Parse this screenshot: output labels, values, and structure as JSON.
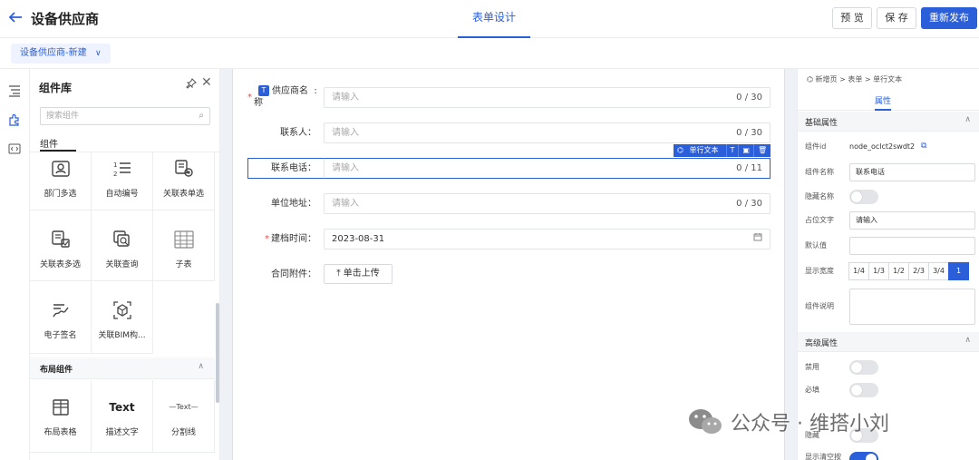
{
  "header": {
    "back_icon": "arrow-left-icon",
    "title": "设备供应商",
    "center_tab": "表单设计",
    "preview_label": "预 览",
    "save_label": "保 存",
    "publish_label": "重新发布"
  },
  "subbar": {
    "form_name": "设备供应商-新建"
  },
  "rail": {
    "icons": [
      "outline-icon",
      "puzzle-icon",
      "code-icon"
    ]
  },
  "library": {
    "title": "组件库",
    "search_placeholder": "搜索组件",
    "tab": "组件",
    "items": [
      {
        "label": "部门多选",
        "icon": "department-icon"
      },
      {
        "label": "自动编号",
        "icon": "numbered-list-icon"
      },
      {
        "label": "关联表单选",
        "icon": "relation-single-icon"
      },
      {
        "label": "关联表多选",
        "icon": "relation-multi-icon"
      },
      {
        "label": "关联查询",
        "icon": "relation-query-icon"
      },
      {
        "label": "子表",
        "icon": "table-icon"
      },
      {
        "label": "电子签名",
        "icon": "signature-icon"
      },
      {
        "label": "关联BIM构...",
        "icon": "cube-icon"
      }
    ],
    "layout_section": "布局组件",
    "layout_items": [
      {
        "label": "布局表格",
        "icon": "grid-icon"
      },
      {
        "label": "描述文字",
        "sample": "Text"
      },
      {
        "label": "分割线",
        "sample": "—Text—"
      }
    ]
  },
  "form": {
    "fields": [
      {
        "label_line1": "供应商名",
        "label_line2": "称",
        "required": true,
        "placeholder": "请输入",
        "counter": "0 / 30",
        "type_badge": "T"
      },
      {
        "label": "联系人：",
        "required": false,
        "placeholder": "请输入",
        "counter": "0 / 30"
      },
      {
        "label": "联系电话：",
        "required": false,
        "placeholder": "请输入",
        "counter": "0 / 11"
      },
      {
        "label": "单位地址：",
        "required": false,
        "placeholder": "请输入",
        "counter": "0 / 30"
      },
      {
        "label": "建档时间：",
        "required": true,
        "value": "2023-08-31",
        "icon": "calendar-icon"
      },
      {
        "label": "合同附件：",
        "required": false,
        "button": "单击上传",
        "icon": "upload-icon"
      }
    ],
    "selected_toolbar": {
      "type_label": "单行文本",
      "text_icon": "T",
      "copy_icon": "copy-icon",
      "delete_icon": "trash-icon"
    }
  },
  "props": {
    "breadcrumb": "新增页 > 表单 > 单行文本",
    "tab": "属性",
    "basic_section": "基础属性",
    "component_id_label": "组件id",
    "component_id_value": "node_oclct2swdt2",
    "component_name_label": "组件名称",
    "component_name_value": "联系电话",
    "hide_name_label": "隐藏名称",
    "placeholder_label": "占位文字",
    "placeholder_value": "请输入",
    "default_label": "默认值",
    "default_value": "",
    "width_label": "显示宽度",
    "width_options": [
      "1/4",
      "1/3",
      "1/2",
      "2/3",
      "3/4",
      "1"
    ],
    "width_selected": "1",
    "desc_label": "组件说明",
    "advanced_section": "高级属性",
    "disabled_label": "禁用",
    "required_label": "必填",
    "hidden_label": "隐藏",
    "show_clear_label": "显示清空按",
    "toggles": {
      "hide_name": false,
      "disabled": false,
      "required": false,
      "hidden": false,
      "show_clear": true
    }
  },
  "watermark": {
    "text": "公众号 · 维搭小刘"
  },
  "colors": {
    "accent": "#2b5fd9",
    "required": "#e34d4d"
  }
}
